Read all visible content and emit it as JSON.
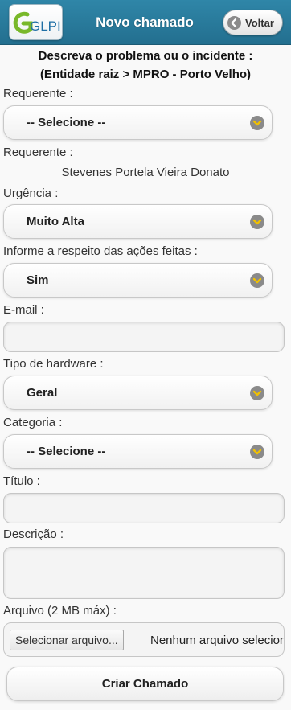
{
  "header": {
    "logo_text": "GLPI",
    "title": "Novo chamado",
    "back_label": "Voltar"
  },
  "intro": {
    "line1": "Descreva o problema ou o incidente :",
    "line2": "(Entidade raiz > MPRO - Porto Velho)"
  },
  "form": {
    "requerente_select_label": "Requerente :",
    "requerente_select_value": "-- Selecione --",
    "requerente_label": "Requerente :",
    "requerente_value": "Stevenes Portela Vieira Donato",
    "urgencia_label": "Urgência :",
    "urgencia_value": "Muito Alta",
    "acoes_label": "Informe a respeito das ações feitas :",
    "acoes_value": "Sim",
    "email_label": "E-mail :",
    "email_value": "",
    "hardware_label": "Tipo de hardware :",
    "hardware_value": "Geral",
    "categoria_label": "Categoria :",
    "categoria_value": "-- Selecione --",
    "titulo_label": "Título :",
    "titulo_value": "",
    "descricao_label": "Descrição :",
    "descricao_value": "",
    "arquivo_label": "Arquivo (2 MB máx) :",
    "file_button": "Selecionar arquivo...",
    "file_status": "Nenhum arquivo selecionado.",
    "submit_label": "Criar Chamado"
  },
  "colors": {
    "header_bg": "#2a7d9f",
    "logo_green": "#78b82a",
    "logo_blue": "#1f6fa5",
    "chevron_icon_bg": "#8a8a8a"
  },
  "icons": {
    "back": "arrow-left-icon",
    "select": "chevron-down-icon"
  }
}
